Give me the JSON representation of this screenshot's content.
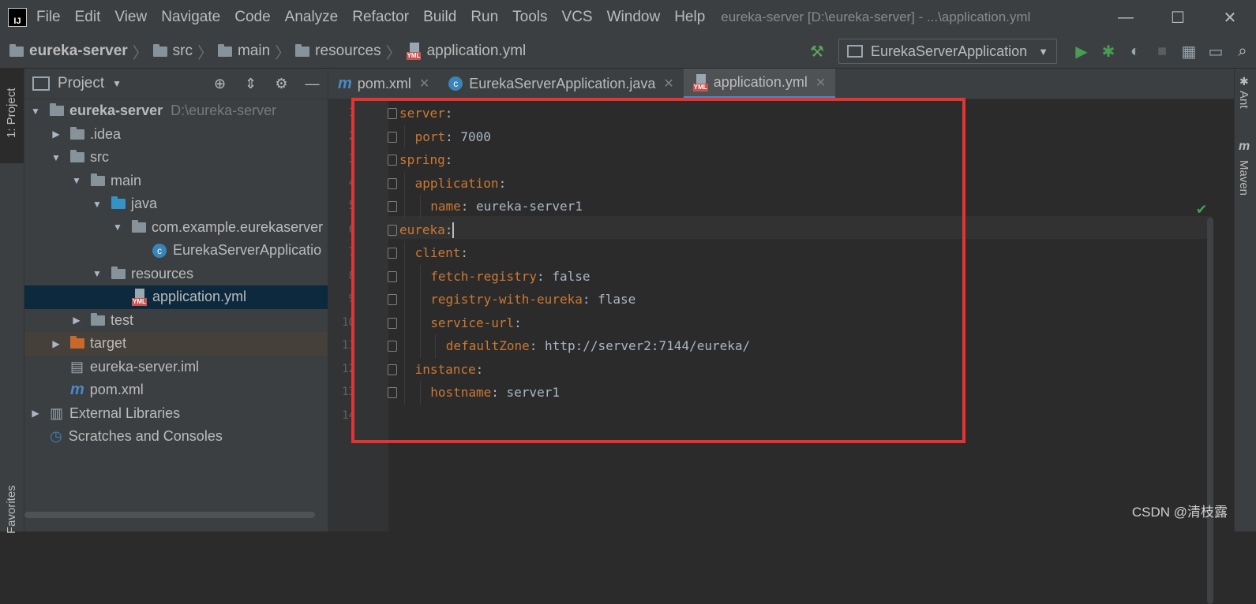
{
  "window": {
    "title": "eureka-server [D:\\eureka-server] - ...\\application.yml",
    "menu": [
      "File",
      "Edit",
      "View",
      "Navigate",
      "Code",
      "Analyze",
      "Refactor",
      "Build",
      "Run",
      "Tools",
      "VCS",
      "Window",
      "Help"
    ]
  },
  "breadcrumb": [
    "eureka-server",
    "src",
    "main",
    "resources",
    "application.yml"
  ],
  "toolbar": {
    "run_config": "EurekaServerApplication"
  },
  "sidebar": {
    "left_tabs": [
      "1: Project",
      "Favorites"
    ],
    "right_tabs": [
      "Ant",
      "Maven"
    ]
  },
  "project_panel": {
    "title": "Project",
    "tree": [
      {
        "label": "eureka-server",
        "hint": "D:\\eureka-server",
        "depth": 0,
        "arrow": "▼",
        "icon": "module"
      },
      {
        "label": ".idea",
        "depth": 1,
        "arrow": "▶",
        "icon": "folder"
      },
      {
        "label": "src",
        "depth": 1,
        "arrow": "▼",
        "icon": "folder"
      },
      {
        "label": "main",
        "depth": 2,
        "arrow": "▼",
        "icon": "folder"
      },
      {
        "label": "java",
        "depth": 3,
        "arrow": "▼",
        "icon": "folder-blue"
      },
      {
        "label": "com.example.eurekaserver",
        "depth": 4,
        "arrow": "▼",
        "icon": "package"
      },
      {
        "label": "EurekaServerApplicatio",
        "depth": 5,
        "arrow": "",
        "icon": "class"
      },
      {
        "label": "resources",
        "depth": 3,
        "arrow": "▼",
        "icon": "resources"
      },
      {
        "label": "application.yml",
        "depth": 4,
        "arrow": "",
        "icon": "yml"
      },
      {
        "label": "test",
        "depth": 2,
        "arrow": "▶",
        "icon": "folder"
      },
      {
        "label": "target",
        "depth": 1,
        "arrow": "▶",
        "icon": "folder-orange"
      },
      {
        "label": "eureka-server.iml",
        "depth": 1,
        "arrow": "",
        "icon": "iml"
      },
      {
        "label": "pom.xml",
        "depth": 1,
        "arrow": "",
        "icon": "maven"
      },
      {
        "label": "External Libraries",
        "depth": 0,
        "arrow": "▶",
        "icon": "libraries"
      },
      {
        "label": "Scratches and Consoles",
        "depth": 0,
        "arrow": "",
        "icon": "scratches"
      }
    ]
  },
  "editor_tabs": [
    {
      "label": "pom.xml",
      "icon": "maven"
    },
    {
      "label": "EurekaServerApplication.java",
      "icon": "class"
    },
    {
      "label": "application.yml",
      "icon": "yml"
    }
  ],
  "code_lines": [
    {
      "n": "1",
      "key": "server",
      "val": "",
      "indent": 0
    },
    {
      "n": "2",
      "key": "port",
      "val": "7000",
      "indent": 1
    },
    {
      "n": "3",
      "key": "spring",
      "val": "",
      "indent": 0
    },
    {
      "n": "4",
      "key": "application",
      "val": "",
      "indent": 1
    },
    {
      "n": "5",
      "key": "name",
      "val": "eureka-server1",
      "indent": 2
    },
    {
      "n": "6",
      "key": "eureka",
      "val": "",
      "indent": 0
    },
    {
      "n": "7",
      "key": "client",
      "val": "",
      "indent": 1
    },
    {
      "n": "8",
      "key": "fetch-registry",
      "val": "false",
      "indent": 2
    },
    {
      "n": "9",
      "key": "registry-with-eureka",
      "val": "flase",
      "indent": 2
    },
    {
      "n": "10",
      "key": "service-url",
      "val": "",
      "indent": 2
    },
    {
      "n": "11",
      "key": "defaultZone",
      "val": "http://server2:7144/eureka/",
      "indent": 3
    },
    {
      "n": "12",
      "key": "instance",
      "val": "",
      "indent": 1
    },
    {
      "n": "13",
      "key": "hostname",
      "val": "server1",
      "indent": 2
    },
    {
      "n": "14",
      "key": "",
      "val": "",
      "indent": 0
    }
  ],
  "watermark": "CSDN @清枝露"
}
